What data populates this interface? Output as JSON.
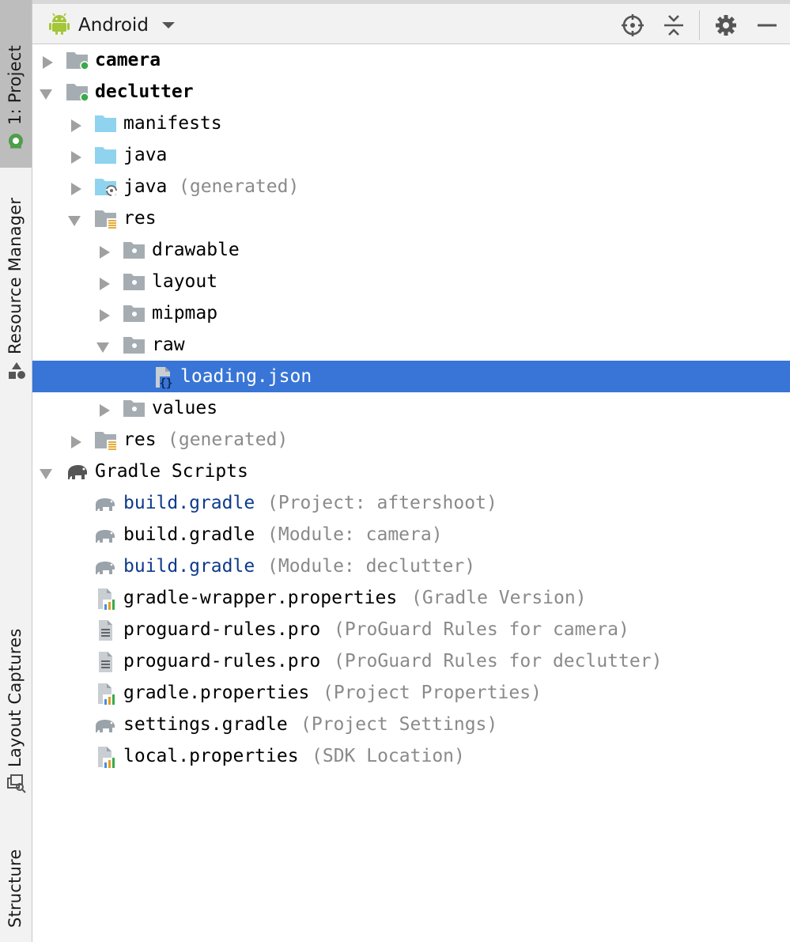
{
  "sidebar": {
    "tabs": [
      {
        "label": "1: Project"
      },
      {
        "label": "Resource Manager"
      },
      {
        "label": "Layout Captures"
      },
      {
        "label": "Structure"
      }
    ]
  },
  "header": {
    "view_label": "Android",
    "tools": [
      "locate-icon",
      "collapse-all-icon",
      "gear-icon",
      "minimize-icon"
    ]
  },
  "tree": {
    "rows": [
      {
        "label": "camera",
        "hint": ""
      },
      {
        "label": "declutter",
        "hint": ""
      },
      {
        "label": "manifests",
        "hint": ""
      },
      {
        "label": "java",
        "hint": ""
      },
      {
        "label": "java",
        "hint": "(generated)"
      },
      {
        "label": "res",
        "hint": ""
      },
      {
        "label": "drawable",
        "hint": ""
      },
      {
        "label": "layout",
        "hint": ""
      },
      {
        "label": "mipmap",
        "hint": ""
      },
      {
        "label": "raw",
        "hint": ""
      },
      {
        "label": "loading.json",
        "hint": ""
      },
      {
        "label": "values",
        "hint": ""
      },
      {
        "label": "res",
        "hint": "(generated)"
      },
      {
        "label": "Gradle Scripts",
        "hint": ""
      },
      {
        "label": "build.gradle",
        "hint": "(Project: aftershoot)"
      },
      {
        "label": "build.gradle",
        "hint": "(Module: camera)"
      },
      {
        "label": "build.gradle",
        "hint": "(Module: declutter)"
      },
      {
        "label": "gradle-wrapper.properties",
        "hint": "(Gradle Version)"
      },
      {
        "label": "proguard-rules.pro",
        "hint": "(ProGuard Rules for camera)"
      },
      {
        "label": "proguard-rules.pro",
        "hint": "(ProGuard Rules for declutter)"
      },
      {
        "label": "gradle.properties",
        "hint": "(Project Properties)"
      },
      {
        "label": "settings.gradle",
        "hint": "(Project Settings)"
      },
      {
        "label": "local.properties",
        "hint": "(SDK Location)"
      }
    ],
    "selected_label": "loading.json"
  },
  "colors": {
    "selection": "#3875d7",
    "link_blue": "#0e3a8c",
    "hint_gray": "#8a8a8a",
    "android_green": "#a4c639",
    "folder_blue": "#8fd3ef",
    "folder_gray": "#a5adb3"
  }
}
